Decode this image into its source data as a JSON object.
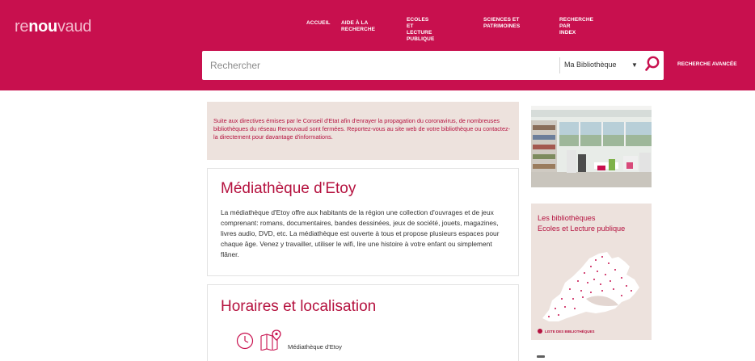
{
  "brand": {
    "logo_prefix": "re",
    "logo_bold": "nou",
    "logo_suffix": "vaud"
  },
  "nav": {
    "accueil": [
      "ACCUEIL"
    ],
    "aide": [
      "AIDE À LA RECHERCHE"
    ],
    "ecoles": [
      "ECOLES ET LECTURE",
      "PUBLIQUE"
    ],
    "sciences": [
      "SCIENCES ET",
      "PATRIMOINES"
    ],
    "index": [
      "RECHERCHE PAR",
      "INDEX"
    ]
  },
  "search": {
    "placeholder": "Rechercher",
    "value": "",
    "scope": "Ma Bibliothèque",
    "advanced": "RECHERCHE AVANCÉE"
  },
  "notice": {
    "text": "Suite aux directives émises par le Conseil d'Etat afin d'enrayer la propagation du coronavirus, de nombreuses bibliothèques du réseau Renouvaud sont fermées. Reportez-vous au site web de votre bibliothèque ou contactez-la directement pour davantage d'informations."
  },
  "library": {
    "title": "Médiathèque d'Etoy",
    "description": "La médiathèque d'Etoy offre aux habitants de la région une collection d'ouvrages et de jeux comprenant: romans, documentaires, bandes dessinées, jeux de société, jouets, magazines, livres audio, DVD, etc. La médiathèque est ouverte à tous et propose plusieurs espaces pour chaque âge. Venez y travailler, utiliser le wifi, lire une histoire à votre enfant ou simplement flâner."
  },
  "hours": {
    "title": "Horaires et localisation",
    "location_name": "Médiathèque d'Etoy",
    "icons": [
      "clock-icon",
      "map-icon"
    ]
  },
  "sidebar": {
    "map_title_line1": "Les bibliothèques",
    "map_title_line2": "Ecoles et Lecture publique",
    "map_link": "LISTE DES BIBLIOTHÈQUES"
  },
  "colors": {
    "brand": "#c8104e",
    "accent_text": "#b5123f",
    "notice_bg": "#ede2dd"
  }
}
